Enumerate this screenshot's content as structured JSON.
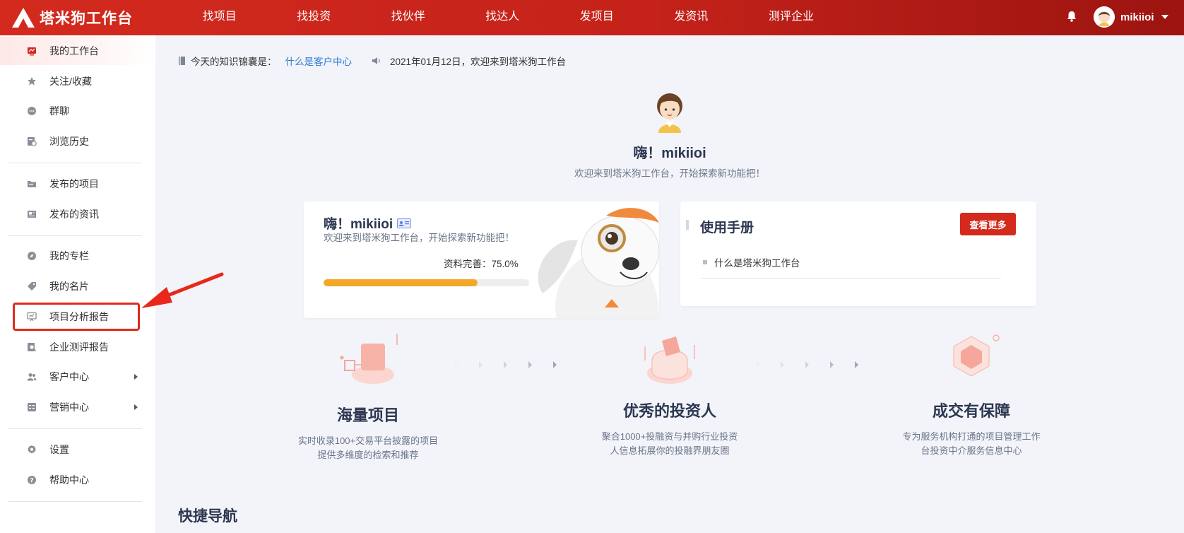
{
  "brand": {
    "name": "塔米狗工作台",
    "logo_icon": "tamigo-logo-icon"
  },
  "nav": [
    "找项目",
    "找投资",
    "找伙伴",
    "找达人",
    "发项目",
    "发资讯",
    "测评企业"
  ],
  "user": {
    "name": "mikiioi",
    "notification_icon": "bell-icon"
  },
  "sidebar": {
    "items": [
      {
        "label": "我的工作台",
        "icon": "dashboard-icon",
        "active": true
      },
      {
        "label": "关注/收藏",
        "icon": "star-icon"
      },
      {
        "label": "群聊",
        "icon": "chat-icon"
      },
      {
        "label": "浏览历史",
        "icon": "history-icon"
      },
      {
        "label": "发布的项目",
        "icon": "folder-icon"
      },
      {
        "label": "发布的资讯",
        "icon": "news-icon"
      },
      {
        "label": "我的专栏",
        "icon": "compass-icon"
      },
      {
        "label": "我的名片",
        "icon": "tag-icon"
      },
      {
        "label": "项目分析报告",
        "icon": "report-icon",
        "highlighted": true
      },
      {
        "label": "企业测评报告",
        "icon": "search-report-icon"
      },
      {
        "label": "客户中心",
        "icon": "users-icon",
        "has_submenu": true
      },
      {
        "label": "营销中心",
        "icon": "marketing-icon",
        "has_submenu": true
      },
      {
        "label": "设置",
        "icon": "gear-icon"
      },
      {
        "label": "帮助中心",
        "icon": "help-icon"
      }
    ]
  },
  "tip": {
    "prefix": "今天的知识锦囊是：",
    "link": "什么是客户中心",
    "announcement": "2021年01月12日，欢迎来到塔米狗工作台"
  },
  "hero": {
    "title": "嗨！mikiioi",
    "subtitle": "欢迎来到塔米狗工作台，开始探索新功能把！"
  },
  "profile_card": {
    "title": "嗨！mikiioi",
    "subtitle": "欢迎来到塔米狗工作台，开始探索新功能把！",
    "progress_label": "资料完善：75.0%",
    "progress": 0.75
  },
  "manual_card": {
    "title": "使用手册",
    "more_button": "查看更多",
    "items": [
      "什么是塔米狗工作台"
    ]
  },
  "features": [
    {
      "title": "海量项目",
      "desc_line1": "实时收录100+交易平台披露的项目",
      "desc_line2": "提供多维度的检索和推荐"
    },
    {
      "title": "优秀的投资人",
      "desc_line1": "聚合1000+投融资与并购行业投资",
      "desc_line2": "人信息拓展你的投融界朋友圈"
    },
    {
      "title": "成交有保障",
      "desc_line1": "专为服务机构打通的项目管理工作",
      "desc_line2": "台投资中介服务信息中心"
    }
  ],
  "quick_nav_title": "快捷导航",
  "colors": {
    "brand_red": "#d42a1e",
    "progress": "#f4a82a",
    "link": "#2a7ad5"
  }
}
